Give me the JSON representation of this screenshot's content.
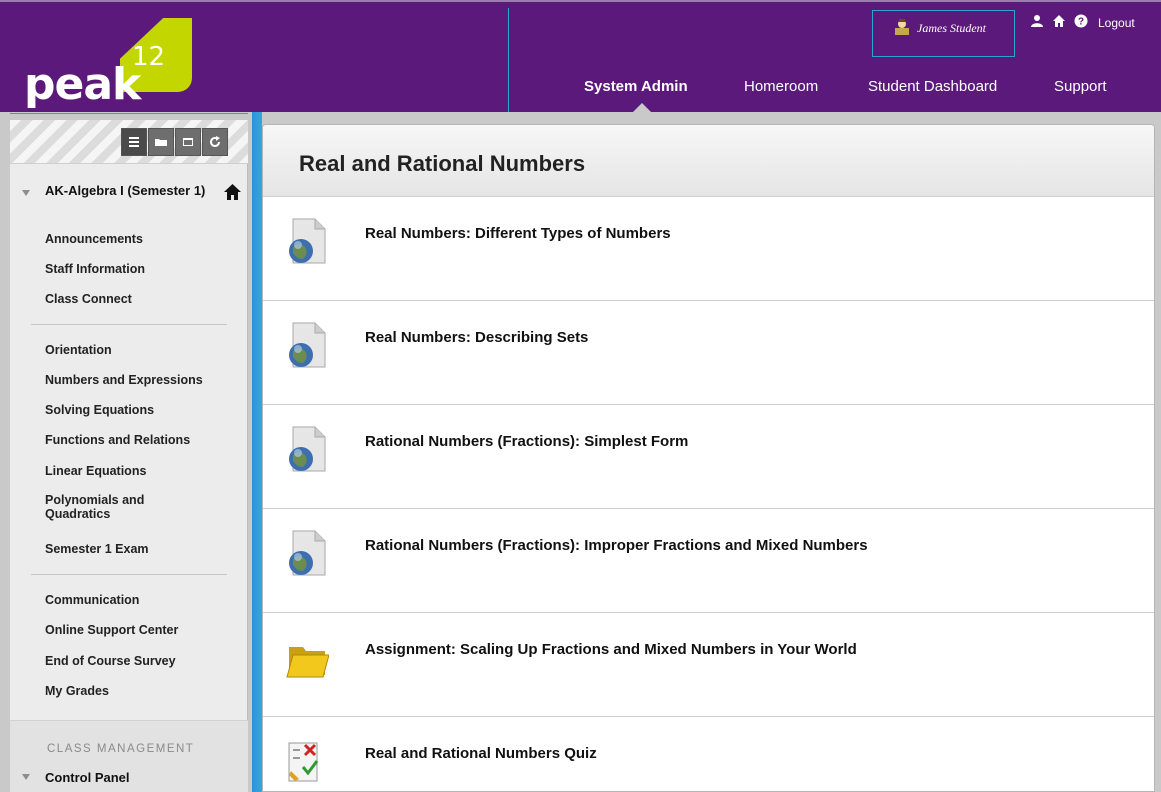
{
  "header": {
    "logo_word": "peak",
    "logo_num": "12",
    "user_name": "James Student",
    "logout": "Logout",
    "nav": [
      {
        "label": "System Admin",
        "active": true
      },
      {
        "label": "Homeroom",
        "active": false
      },
      {
        "label": "Student Dashboard",
        "active": false
      },
      {
        "label": "Support",
        "active": false
      }
    ]
  },
  "sidebar": {
    "tools": [
      "list-view-icon",
      "folder-view-icon",
      "window-icon",
      "refresh-icon"
    ],
    "course_title": "AK-Algebra I (Semester 1)",
    "group1": [
      "Announcements",
      "Staff Information",
      "Class Connect"
    ],
    "group2": [
      "Orientation",
      "Numbers and Expressions",
      "Solving Equations",
      "Functions and Relations",
      "Linear Equations",
      "Polynomials and Quadratics",
      "Semester 1 Exam"
    ],
    "group3": [
      "Communication",
      "Online Support Center",
      "End of Course Survey",
      "My Grades"
    ],
    "class_management": "CLASS MANAGEMENT",
    "control_panel": "Control Panel"
  },
  "content": {
    "title": "Real and Rational Numbers",
    "items": [
      {
        "title": "Real Numbers: Different Types of Numbers",
        "icon": "web-link-icon"
      },
      {
        "title": "Real Numbers: Describing Sets",
        "icon": "web-link-icon"
      },
      {
        "title": "Rational Numbers (Fractions): Simplest Form",
        "icon": "web-link-icon"
      },
      {
        "title": "Rational Numbers (Fractions): Improper Fractions and Mixed Numbers",
        "icon": "web-link-icon"
      },
      {
        "title": "Assignment: Scaling Up Fractions and Mixed Numbers in Your World",
        "icon": "folder-icon"
      },
      {
        "title": "Real and Rational Numbers Quiz",
        "icon": "quiz-icon"
      }
    ]
  },
  "colors": {
    "header_bg": "#5b1a7b",
    "logo_tile": "#c4d600",
    "focus_outline": "#2aa3d8"
  }
}
